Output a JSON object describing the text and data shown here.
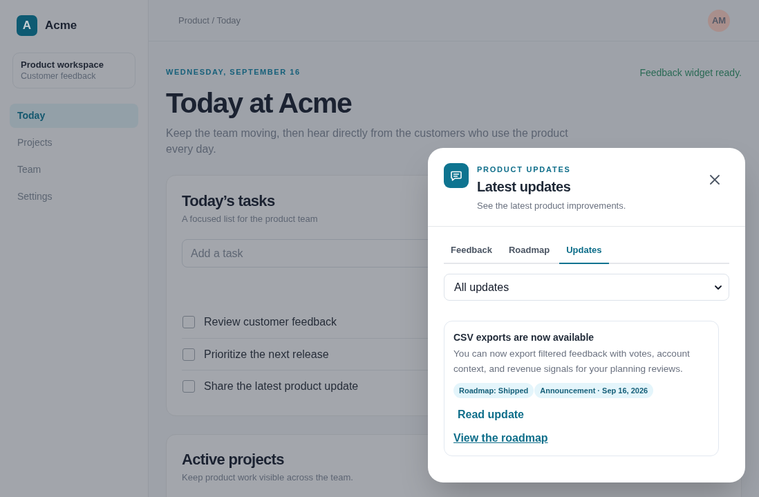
{
  "sidebar": {
    "logo": {
      "letter": "A",
      "name": "Acme"
    },
    "workspace": {
      "title": "Product workspace",
      "subtitle": "Customer feedback"
    },
    "nav": [
      {
        "label": "Today",
        "selected": true
      },
      {
        "label": "Projects",
        "selected": false
      },
      {
        "label": "Team",
        "selected": false
      },
      {
        "label": "Settings",
        "selected": false
      }
    ]
  },
  "header": {
    "breadcrumb": "Product / Today",
    "avatar": "AM"
  },
  "page": {
    "eyebrow": "WEDNESDAY, SEPTEMBER 16",
    "status": "Feedback widget ready.",
    "title": "Today at Acme",
    "subtitle": "Keep the team moving, then hear directly from the customers who use the product every day."
  },
  "tasks_card": {
    "title": "Today’s tasks",
    "subtitle": "A focused list for the product team",
    "input": {
      "placeholder": "Add a task"
    },
    "tasks": [
      {
        "label": "Review customer feedback",
        "checked": false
      },
      {
        "label": "Prioritize the next release",
        "checked": false
      },
      {
        "label": "Share the latest product update",
        "checked": false
      }
    ]
  },
  "projects_card": {
    "title": "Active projects",
    "subtitle": "Keep product work visible across the team."
  },
  "widget": {
    "eyebrow": "PRODUCT UPDATES",
    "title": "Latest updates",
    "subtitle": "See the latest product improvements.",
    "tabs": [
      {
        "label": "Feedback",
        "selected": false
      },
      {
        "label": "Roadmap",
        "selected": false
      },
      {
        "label": "Updates",
        "selected": true
      }
    ],
    "filter": {
      "value": "All updates"
    },
    "updates": [
      {
        "title": "CSV exports are now available",
        "body": "You can now export filtered feedback with votes, account context, and revenue signals for your planning reviews.",
        "tags": [
          "Roadmap: Shipped",
          "Announcement · Sep 16, 2026"
        ],
        "action": "Read update",
        "link": "View the roadmap"
      }
    ]
  }
}
